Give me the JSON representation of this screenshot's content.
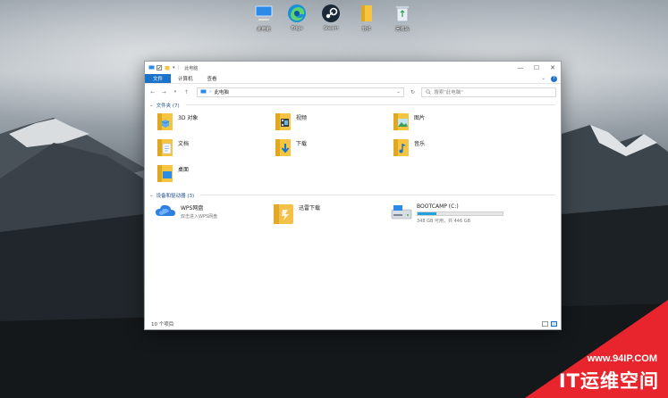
{
  "desktop": {
    "icons": [
      {
        "label": "此电脑",
        "icon": "computer-icon"
      },
      {
        "label": "Edge",
        "icon": "edge-icon"
      },
      {
        "label": "Steam",
        "icon": "steam-icon"
      },
      {
        "label": "软件",
        "icon": "folder-icon"
      },
      {
        "label": "回收站",
        "icon": "recycle-bin-icon"
      }
    ]
  },
  "window": {
    "title": "此电脑",
    "controls": {
      "minimize": "—",
      "maximize": "☐",
      "close": "✕"
    },
    "ribbon": {
      "tabs": [
        "文件",
        "计算机",
        "查看"
      ]
    },
    "address": {
      "path": "此电脑",
      "separator": "›"
    },
    "search": {
      "placeholder": "搜索\"此电脑\""
    },
    "folders_group": {
      "header": "文件夹 (7)"
    },
    "folders": [
      {
        "label": "3D 对象",
        "icon": "3d-objects-folder-icon"
      },
      {
        "label": "视频",
        "icon": "videos-folder-icon"
      },
      {
        "label": "图片",
        "icon": "pictures-folder-icon"
      },
      {
        "label": "文档",
        "icon": "documents-folder-icon"
      },
      {
        "label": "下载",
        "icon": "downloads-folder-icon"
      },
      {
        "label": "音乐",
        "icon": "music-folder-icon"
      },
      {
        "label": "桌面",
        "icon": "desktop-folder-icon"
      }
    ],
    "devices_group": {
      "header": "设备和驱动器 (3)"
    },
    "devices": [
      {
        "name": "WPS网盘",
        "sub": "双击进入WPS网盘",
        "icon": "cloud-drive-icon"
      },
      {
        "name": "迅雷下载",
        "sub": "",
        "icon": "xunlei-download-icon"
      },
      {
        "name": "BOOTCAMP (C:)",
        "sub": "348 GB 可用，共 446 GB",
        "icon": "disk-drive-icon",
        "used_fraction": 0.22
      }
    ],
    "status": {
      "count": "10 个项目"
    }
  },
  "colors": {
    "accent": "#1a73c8",
    "drive_bar": "#26a0da",
    "folder": "#f5c542",
    "watermark": "#e8242c"
  },
  "watermark": {
    "url": "www.94IP.COM",
    "name": "IT运维空间"
  }
}
